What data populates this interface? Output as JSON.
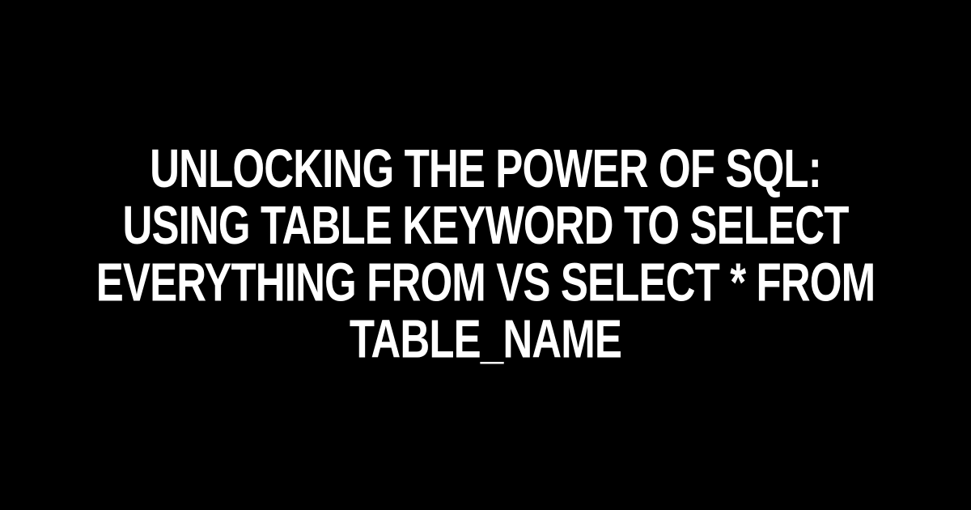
{
  "title": "Unlocking the Power of SQL: Using TABLE Keyword to Select Everything From vs SELECT * FROM table_name"
}
